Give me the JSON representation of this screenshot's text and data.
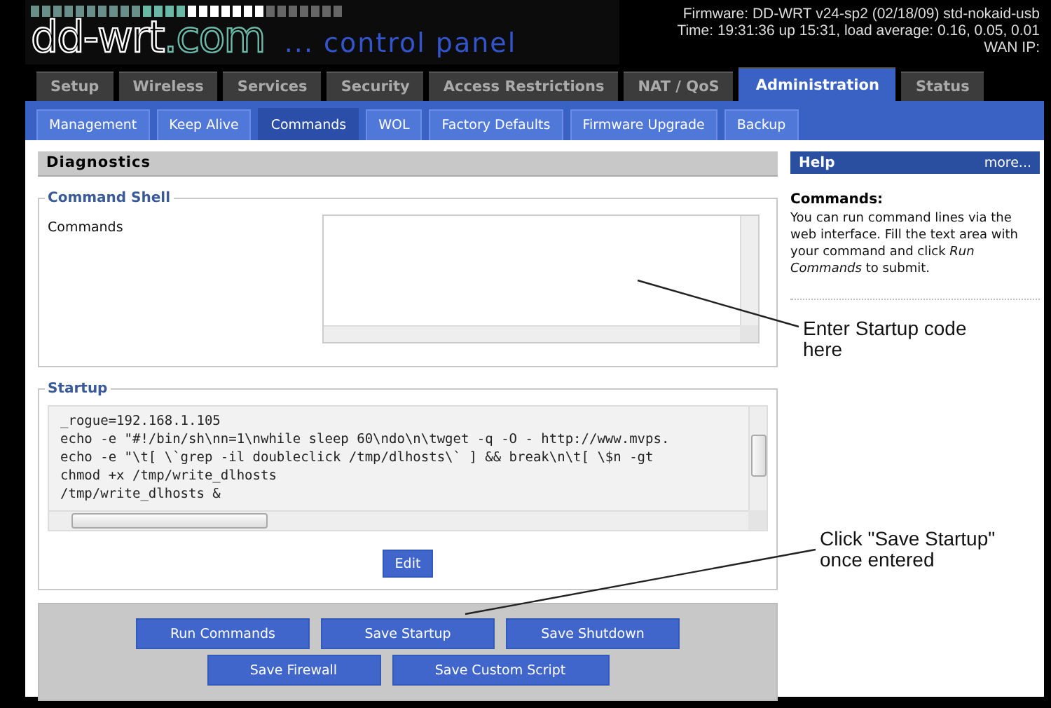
{
  "header": {
    "logo_main": "dd-wrt",
    "logo_domain": ".com",
    "logo_subtitle": "... control panel",
    "firmware": "Firmware: DD-WRT v24-sp2 (02/18/09) std-nokaid-usb",
    "time": "Time: 19:31:36 up 15:31, load average: 0.16, 0.05, 0.01",
    "wan_ip_label": "WAN IP:"
  },
  "tabs": [
    {
      "label": "Setup",
      "selected": false
    },
    {
      "label": "Wireless",
      "selected": false
    },
    {
      "label": "Services",
      "selected": false
    },
    {
      "label": "Security",
      "selected": false
    },
    {
      "label": "Access Restrictions",
      "selected": false
    },
    {
      "label": "NAT / QoS",
      "selected": false
    },
    {
      "label": "Administration",
      "selected": true
    },
    {
      "label": "Status",
      "selected": false
    }
  ],
  "subtabs": [
    {
      "label": "Management",
      "selected": false
    },
    {
      "label": "Keep Alive",
      "selected": false
    },
    {
      "label": "Commands",
      "selected": true
    },
    {
      "label": "WOL",
      "selected": false
    },
    {
      "label": "Factory Defaults",
      "selected": false
    },
    {
      "label": "Firmware Upgrade",
      "selected": false
    },
    {
      "label": "Backup",
      "selected": false
    }
  ],
  "main": {
    "title": "Diagnostics",
    "command_shell": {
      "legend": "Command Shell",
      "label": "Commands"
    },
    "startup": {
      "legend": "Startup",
      "lines": [
        "_rogue=192.168.1.105",
        "echo -e \"#!/bin/sh\\nn=1\\nwhile sleep 60\\ndo\\n\\twget -q -O - http://www.mvps.",
        "echo -e \"\\t[ \\`grep -il doubleclick /tmp/dlhosts\\` ] && break\\n\\t[ \\$n -gt",
        "chmod +x /tmp/write_dlhosts",
        "/tmp/write_dlhosts &"
      ],
      "edit_button": "Edit"
    },
    "button_rows": [
      [
        "Run Commands",
        "Save Startup",
        "Save Shutdown"
      ],
      [
        "Save Firewall",
        "Save Custom Script"
      ]
    ]
  },
  "help": {
    "title": "Help",
    "more": "more...",
    "heading": "Commands:",
    "text": "You can run command lines via the web interface. Fill the text area with your command and click *Run Commands* to submit."
  },
  "annotations": [
    {
      "text": "Enter Startup code here"
    },
    {
      "text": "Click \"Save Startup\" once entered"
    }
  ]
}
